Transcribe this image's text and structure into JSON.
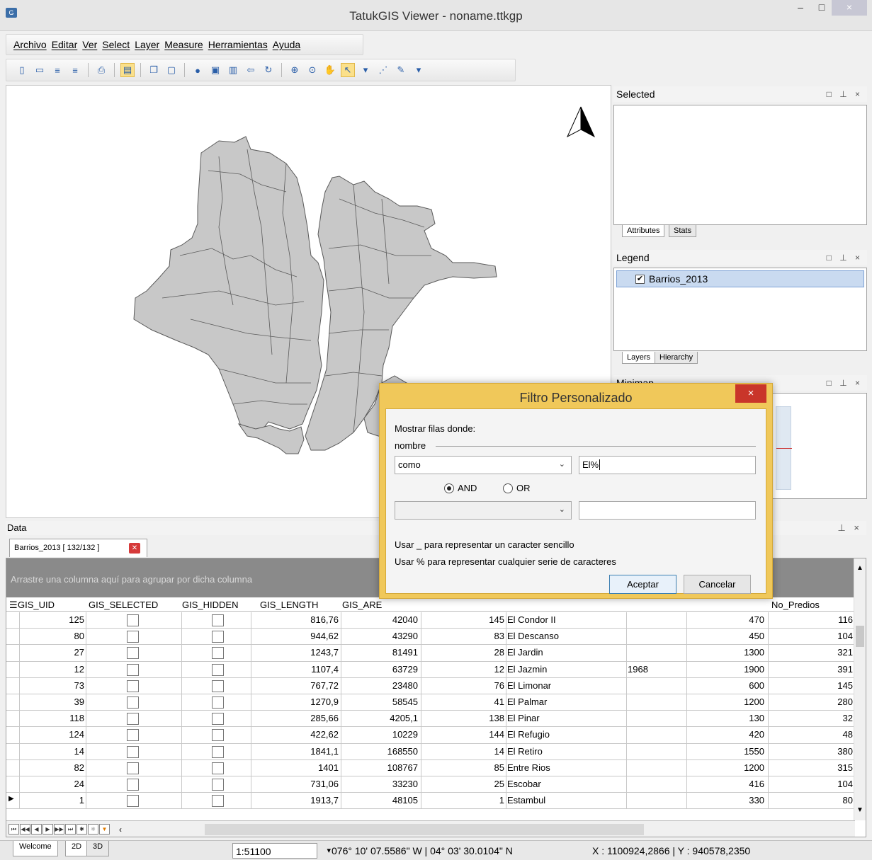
{
  "window": {
    "title": "TatukGIS Viewer - noname.ttkgp",
    "minimize": "–",
    "maximize": "□",
    "close": "×"
  },
  "menu": [
    "Archivo",
    "Editar",
    "Ver",
    "Select",
    "Layer",
    "Measure",
    "Herramientas",
    "Ayuda"
  ],
  "panels": {
    "selected": {
      "title": "Selected",
      "tabs": [
        "Attributes",
        "Stats"
      ]
    },
    "legend": {
      "title": "Legend",
      "layer": "Barrios_2013",
      "tabs": [
        "Layers",
        "Hierarchy"
      ]
    },
    "minimap": {
      "title": "Minimap"
    },
    "data": {
      "title": "Data",
      "tab": "Barrios_2013 [ 132/132 ]"
    }
  },
  "grid": {
    "group_hint": "Arrastre una columna aquí para agrupar por dicha columna",
    "headers": [
      "GIS_UID",
      "GIS_SELECTED",
      "GIS_HIDDEN",
      "GIS_LENGTH",
      "GIS_ARE",
      "No_Predios"
    ],
    "rows": [
      [
        "125",
        "816,76",
        "42040",
        "145",
        "El Condor II",
        "",
        "470",
        "116"
      ],
      [
        "80",
        "944,62",
        "43290",
        "83",
        "El Descanso",
        "",
        "450",
        "104"
      ],
      [
        "27",
        "1243,7",
        "81491",
        "28",
        "El Jardin",
        "",
        "1300",
        "321"
      ],
      [
        "12",
        "1107,4",
        "63729",
        "12",
        "El Jazmin",
        "1968",
        "1900",
        "391"
      ],
      [
        "73",
        "767,72",
        "23480",
        "76",
        "El Limonar",
        "",
        "600",
        "145"
      ],
      [
        "39",
        "1270,9",
        "58545",
        "41",
        "El Palmar",
        "",
        "1200",
        "280"
      ],
      [
        "118",
        "285,66",
        "4205,1",
        "138",
        "El Pinar",
        "",
        "130",
        "32"
      ],
      [
        "124",
        "422,62",
        "10229",
        "144",
        "El Refugio",
        "",
        "420",
        "48"
      ],
      [
        "14",
        "1841,1",
        "168550",
        "14",
        "El Retiro",
        "",
        "1550",
        "380"
      ],
      [
        "82",
        "1401",
        "108767",
        "85",
        "Entre Rios",
        "",
        "1200",
        "315"
      ],
      [
        "24",
        "731,06",
        "33230",
        "25",
        "Escobar",
        "",
        "416",
        "104"
      ],
      [
        "1",
        "1913,7",
        "48105",
        "1",
        "Estambul",
        "",
        "330",
        "80"
      ]
    ]
  },
  "dialog": {
    "title": "Filtro Personalizado",
    "close": "×",
    "label_show": "Mostrar filas donde:",
    "field": "nombre",
    "operator1": "como",
    "value1": "El%",
    "and_label": "AND",
    "or_label": "OR",
    "operator2": "",
    "value2": "",
    "hint1": "Usar _ para representar un caracter sencillo",
    "hint2": "Usar % para representar cualquier serie de caracteres",
    "accept": "Aceptar",
    "cancel": "Cancelar"
  },
  "statusbar": {
    "tabs": [
      "Welcome",
      "2D",
      "3D"
    ],
    "scale": "1:51100",
    "geo_coords": "076° 10' 07.5586\" W | 04° 03' 30.0104\" N",
    "xy_coords": "X : 1100924,2866 | Y : 940578,2350"
  },
  "colors": {
    "map_fill": "#c8c8c8",
    "map_stroke": "#5a5a5a",
    "dialog_frame": "#f0c85a",
    "close_red": "#c9352a",
    "legend_highlight": "#c9daf0"
  }
}
